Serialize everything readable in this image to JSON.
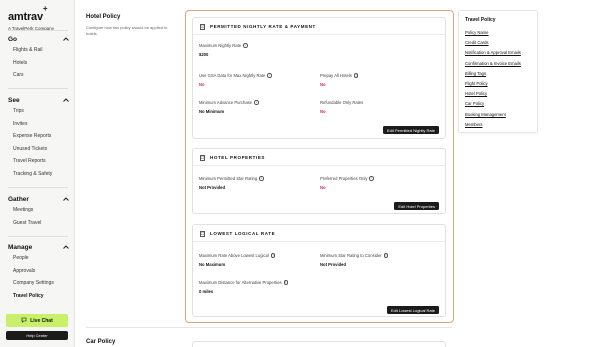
{
  "brand": {
    "name": "amtrav",
    "plus": "+",
    "subtitle": "A TravelPerk Company"
  },
  "sidebar": {
    "sections": [
      {
        "title": "Go",
        "items": [
          "Flights & Rail",
          "Hotels",
          "Cars"
        ]
      },
      {
        "title": "See",
        "items": [
          "Trips",
          "Invites",
          "Expense Reports",
          "Unused Tickets",
          "Travel Reports",
          "Tracking & Safety"
        ]
      },
      {
        "title": "Gather",
        "items": [
          "Meetings",
          "Guest Travel"
        ]
      },
      {
        "title": "Manage",
        "items": [
          "People",
          "Approvals",
          "Company Settings",
          "Travel Policy"
        ]
      }
    ],
    "live_chat": "Live Chat",
    "help_center": "Help Center"
  },
  "main": {
    "hotel_policy_title": "Hotel Policy",
    "hotel_policy_desc": "Configure how this policy should be applied to hotels.",
    "car_policy_title": "Car Policy",
    "cards": {
      "permitted": {
        "title": "PERMITTED NIGHTLY RATE & PAYMENT",
        "max_rate_label": "Maximum Nightly Rate",
        "max_rate_value": "$200",
        "gsa_label": "Use GSA Data for Max Nightly Rate",
        "gsa_value": "No",
        "prepay_label": "Prepay All Hotels",
        "prepay_value": "No",
        "min_adv_label": "Minimum Advance Purchase",
        "min_adv_value": "No Minimum",
        "refundable_label": "Refundable Only Rates",
        "refundable_value": "No",
        "button": "Edit Permitted Nightly Rate"
      },
      "properties": {
        "title": "HOTEL PROPERTIES",
        "star_label": "Minimum Permitted Star Rating",
        "star_value": "Not Provided",
        "preferred_label": "Preferred Properties Only",
        "preferred_value": "No",
        "button": "Edit Hotel Properties"
      },
      "lowest": {
        "title": "LOWEST LOGICAL RATE",
        "above_label": "Maximum Rate Above Lowest Logical",
        "above_value": "No Maximum",
        "min_star_label": "Minimum Star Rating to Consider",
        "min_star_value": "Not Provided",
        "distance_label": "Maximum Distance for Alternative Properties",
        "distance_value": "0 miles",
        "button": "Edit Lowest Logical Rate"
      }
    }
  },
  "toc": {
    "title": "Travel Policy",
    "links": [
      "Policy Name",
      "Credit Cards",
      "Notification & Approval Emails",
      "Confirmation & Invoice Emails",
      "Billing Tags",
      "Flight Policy",
      "Hotel Policy",
      "Car Policy",
      "Booking Management",
      "Members"
    ]
  },
  "colors": {
    "accent_border": "#e2a27b",
    "live_chat_bg": "#c8f06a",
    "negative_value": "#c8324a"
  }
}
